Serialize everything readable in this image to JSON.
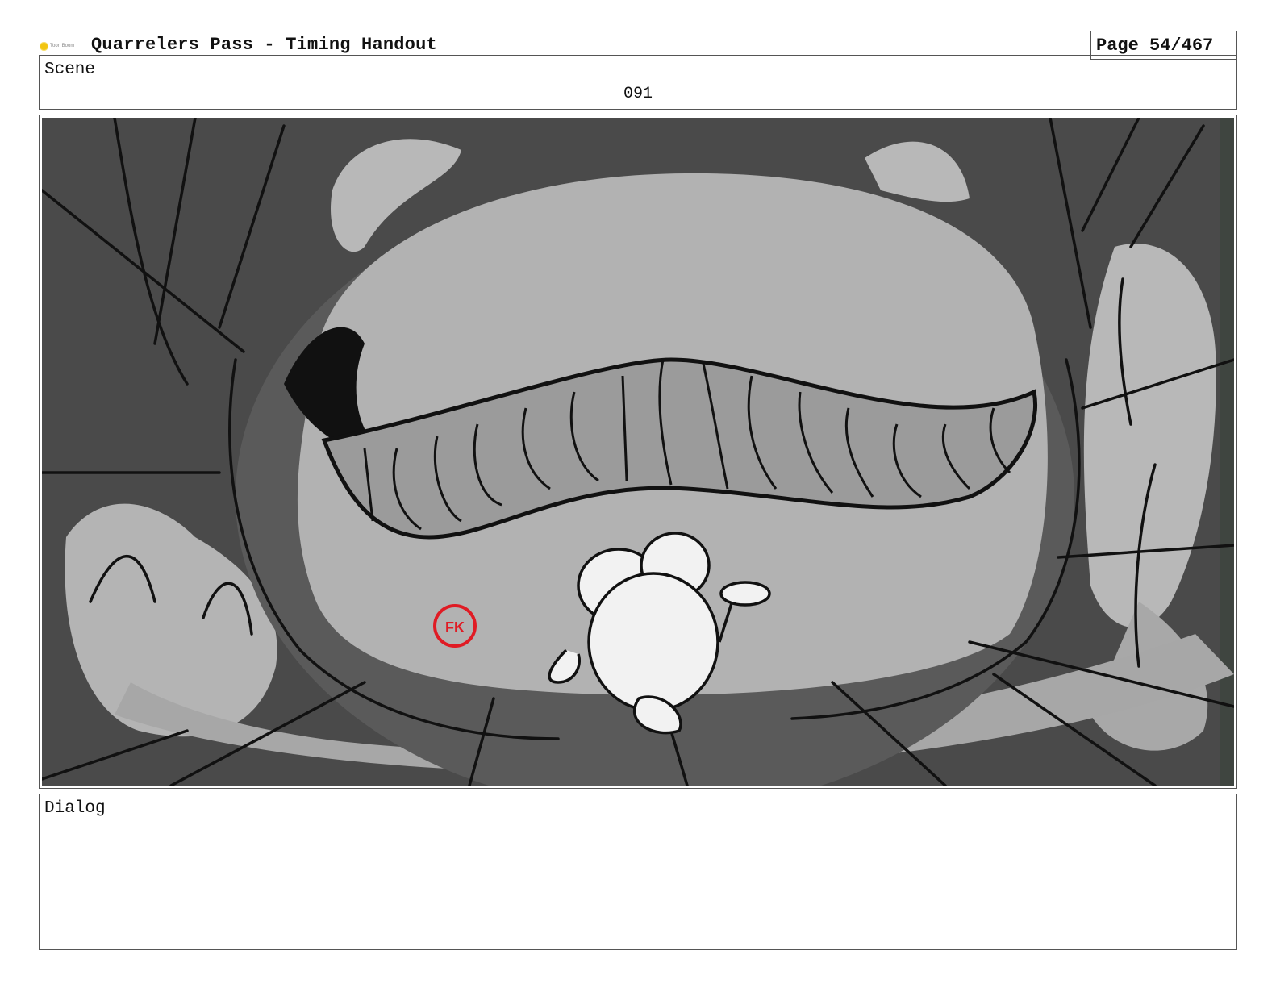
{
  "header": {
    "logo_text": "Toon Boom",
    "title": "Quarrelers Pass - Timing Handout",
    "page": "Page  54/467"
  },
  "scene": {
    "label": "Scene",
    "number": "091"
  },
  "panel": {
    "art": "storyboard-sketch",
    "annotation": "FK"
  },
  "dialog": {
    "label": "Dialog",
    "text": ""
  },
  "colors": {
    "border": "#555555",
    "art_dark": "#4a4a4a",
    "art_mid": "#9e9e9e",
    "art_light": "#b9b9b9",
    "annotation_red": "#e01b24"
  }
}
